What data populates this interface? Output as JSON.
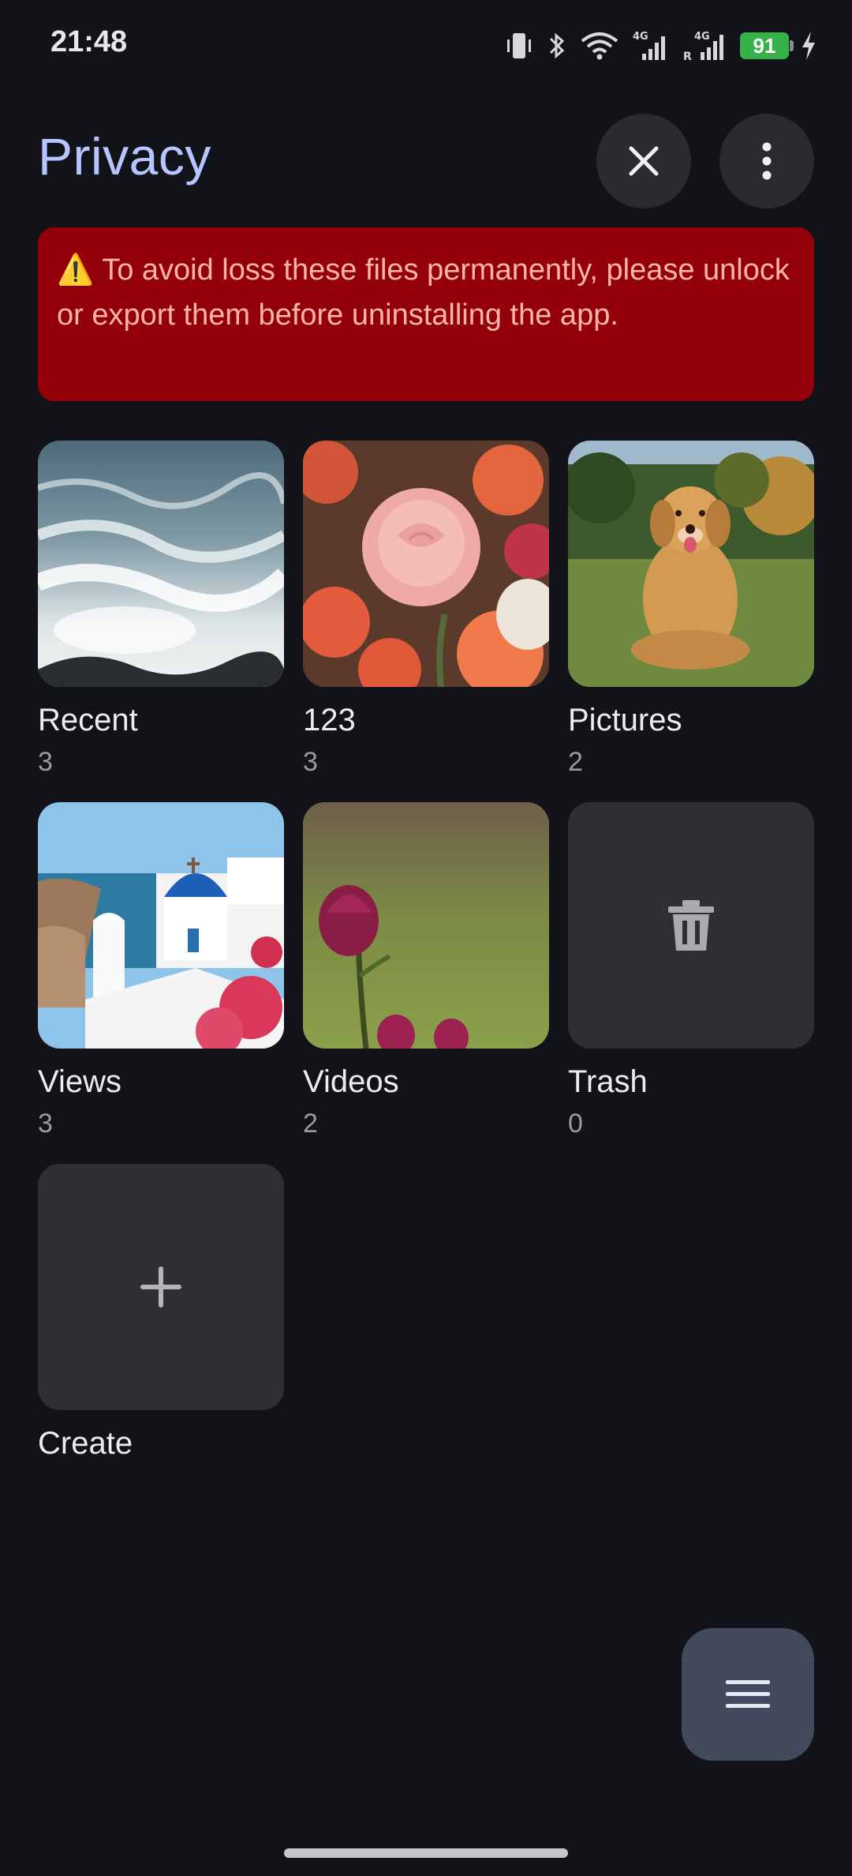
{
  "status_bar": {
    "time": "21:48",
    "battery": "91",
    "icons": [
      "vibrate-icon",
      "bluetooth-icon",
      "wifi-icon",
      "signal-4g-icon",
      "signal-4g-roaming-icon",
      "battery-icon",
      "charging-icon"
    ]
  },
  "header": {
    "title": "Privacy",
    "close_icon": "close-icon",
    "more_icon": "more-vert-icon"
  },
  "warning": {
    "icon": "⚠️",
    "text": "To avoid loss these files permanently, please unlock or export them before uninstalling the app."
  },
  "albums": [
    {
      "name": "Recent",
      "count": "3"
    },
    {
      "name": "123",
      "count": "3"
    },
    {
      "name": "Pictures",
      "count": "2"
    },
    {
      "name": "Views",
      "count": "3"
    },
    {
      "name": "Videos",
      "count": "2"
    },
    {
      "name": "Trash",
      "count": "0"
    },
    {
      "name": "Create",
      "count": ""
    }
  ],
  "fab": {
    "icon": "hamburger-menu-icon"
  },
  "colors": {
    "background": "#121318",
    "title": "#b6c4ff",
    "warning_bg": "#93000a",
    "warning_text": "#ffb4a9",
    "tile_bg": "#2e2e34",
    "fab_bg": "#434a5e",
    "battery": "#36b24a"
  }
}
